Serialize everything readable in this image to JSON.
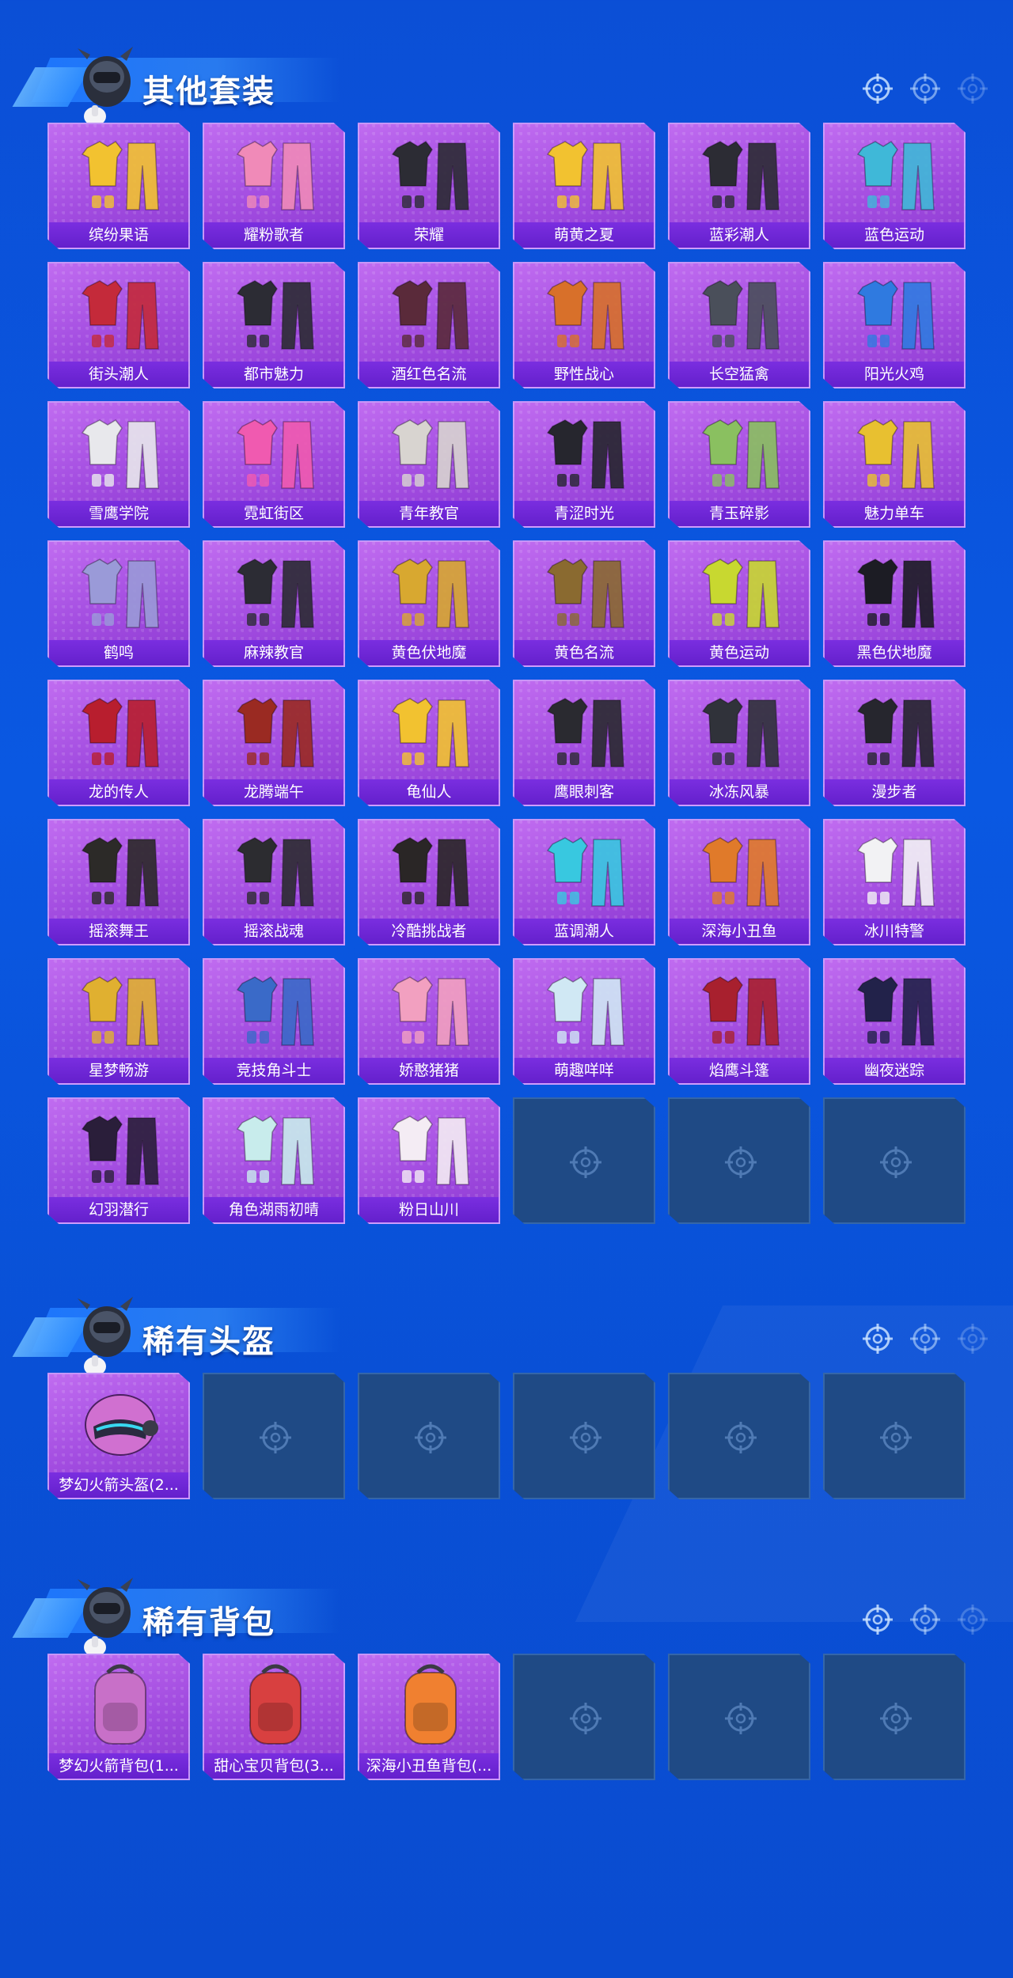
{
  "colors": {
    "background": "#0a52da",
    "card_purple": "#a24ce0",
    "label_purple": "#6a24d0",
    "empty_card": "#1f4a85"
  },
  "sections": [
    {
      "title": "其他套装",
      "items": [
        {
          "label": "缤纷果语",
          "icon": "outfit-yellow-icon",
          "color": "#f2c230"
        },
        {
          "label": "耀粉歌者",
          "icon": "outfit-pink-icon",
          "color": "#f08ab8"
        },
        {
          "label": "荣耀",
          "icon": "outfit-black-icon",
          "color": "#2c2c34"
        },
        {
          "label": "萌黄之夏",
          "icon": "outfit-yellow-icon",
          "color": "#f2c230"
        },
        {
          "label": "蓝彩潮人",
          "icon": "outfit-black-icon",
          "color": "#2c2c34"
        },
        {
          "label": "蓝色运动",
          "icon": "outfit-cyan-icon",
          "color": "#3fb8d8"
        },
        {
          "label": "街头潮人",
          "icon": "outfit-red-icon",
          "color": "#c42a3a"
        },
        {
          "label": "都市魅力",
          "icon": "outfit-black-icon",
          "color": "#2c2c34"
        },
        {
          "label": "酒红色名流",
          "icon": "outfit-maroon-icon",
          "color": "#5a2a3a"
        },
        {
          "label": "野性战心",
          "icon": "outfit-orange-icon",
          "color": "#d8702a"
        },
        {
          "label": "长空猛禽",
          "icon": "outfit-gray-icon",
          "color": "#4a4f5a"
        },
        {
          "label": "阳光火鸡",
          "icon": "outfit-blue-icon",
          "color": "#2f7ae0"
        },
        {
          "label": "雪鹰学院",
          "icon": "outfit-white-icon",
          "color": "#e8e8ec"
        },
        {
          "label": "霓虹街区",
          "icon": "outfit-pink-icon",
          "color": "#f05ab0"
        },
        {
          "label": "青年教官",
          "icon": "outfit-white-icon",
          "color": "#d8d4d0"
        },
        {
          "label": "青涩时光",
          "icon": "outfit-black-icon",
          "color": "#26262e"
        },
        {
          "label": "青玉碎影",
          "icon": "outfit-green-icon",
          "color": "#8ac060"
        },
        {
          "label": "魅力单车",
          "icon": "outfit-yellow-icon",
          "color": "#e8c030"
        },
        {
          "label": "鹤鸣",
          "icon": "outfit-lavender-icon",
          "color": "#9a9ad8"
        },
        {
          "label": "麻辣教官",
          "icon": "outfit-black-icon",
          "color": "#2c2c34"
        },
        {
          "label": "黄色伏地魔",
          "icon": "outfit-yellow-icon",
          "color": "#d8a830"
        },
        {
          "label": "黄色名流",
          "icon": "outfit-brown-icon",
          "color": "#8a6a30"
        },
        {
          "label": "黄色运动",
          "icon": "outfit-lime-icon",
          "color": "#c8d830"
        },
        {
          "label": "黑色伏地魔",
          "icon": "outfit-black-icon",
          "color": "#1c1c24"
        },
        {
          "label": "龙的传人",
          "icon": "outfit-red-icon",
          "color": "#b81e2e"
        },
        {
          "label": "龙腾端午",
          "icon": "outfit-red-icon",
          "color": "#9a2a22"
        },
        {
          "label": "龟仙人",
          "icon": "outfit-yellow-icon",
          "color": "#f2c230"
        },
        {
          "label": "鹰眼刺客",
          "icon": "outfit-black-icon",
          "color": "#2a2a30"
        },
        {
          "label": "冰冻风暴",
          "icon": "outfit-black-icon",
          "color": "#30323a"
        },
        {
          "label": "漫步者",
          "icon": "outfit-black-icon",
          "color": "#26262e"
        },
        {
          "label": "摇滚舞王",
          "icon": "outfit-black-icon",
          "color": "#2c2a28"
        },
        {
          "label": "摇滚战魂",
          "icon": "outfit-black-icon",
          "color": "#2c2c30"
        },
        {
          "label": "冷酷挑战者",
          "icon": "outfit-black-icon",
          "color": "#2a2626"
        },
        {
          "label": "蓝调潮人",
          "icon": "outfit-cyan-icon",
          "color": "#38c8e0"
        },
        {
          "label": "深海小丑鱼",
          "icon": "outfit-orange-icon",
          "color": "#e07a2a"
        },
        {
          "label": "冰川特警",
          "icon": "outfit-white-icon",
          "color": "#f2f2f4"
        },
        {
          "label": "星梦畅游",
          "icon": "outfit-gold-icon",
          "color": "#e0b030"
        },
        {
          "label": "竞技角斗士",
          "icon": "outfit-blue-icon",
          "color": "#3a6ac8"
        },
        {
          "label": "娇憨猪猪",
          "icon": "outfit-pink-icon",
          "color": "#f2a0c0"
        },
        {
          "label": "萌趣咩咩",
          "icon": "outfit-white-icon",
          "color": "#d0e8f4"
        },
        {
          "label": "焰鹰斗篷",
          "icon": "outfit-red-icon",
          "color": "#a8202e"
        },
        {
          "label": "幽夜迷踪",
          "icon": "outfit-navy-icon",
          "color": "#22224a"
        },
        {
          "label": "幻羽潜行",
          "icon": "outfit-black-icon",
          "color": "#2a1e3a"
        },
        {
          "label": "角色湖雨初晴",
          "icon": "outfit-mint-icon",
          "color": "#c8ecec"
        },
        {
          "label": "粉日山川",
          "icon": "outfit-white-icon",
          "color": "#f4ecf4"
        }
      ],
      "empty_slots": 3
    },
    {
      "title": "稀有头盔",
      "items": [
        {
          "label": "梦幻火箭头盔(2...",
          "icon": "helmet-icon",
          "color": "#d070d0"
        }
      ],
      "empty_slots": 5
    },
    {
      "title": "稀有背包",
      "items": [
        {
          "label": "梦幻火箭背包(1...",
          "icon": "backpack-icon",
          "color": "#c870c8"
        },
        {
          "label": "甜心宝贝背包(3...",
          "icon": "backpack-icon",
          "color": "#d84040"
        },
        {
          "label": "深海小丑鱼背包(...",
          "icon": "backpack-icon",
          "color": "#f08030"
        }
      ],
      "empty_slots": 3
    }
  ]
}
